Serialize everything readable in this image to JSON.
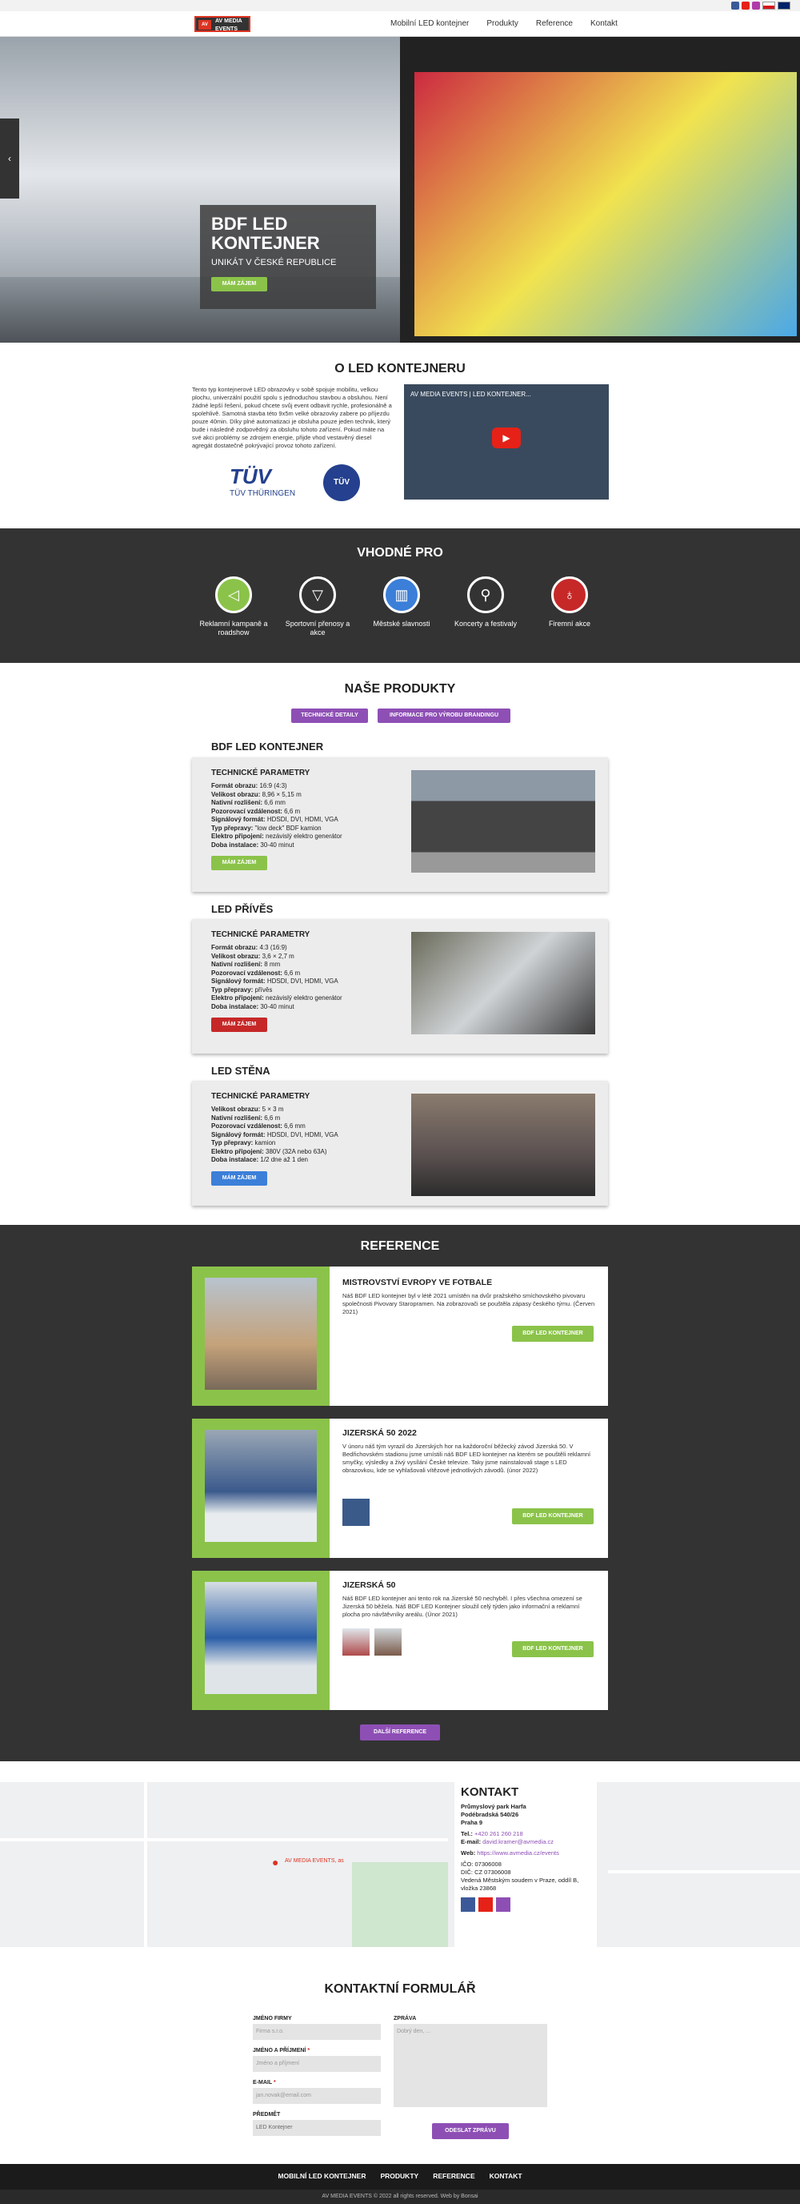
{
  "nav": {
    "logo_text": "AV MEDIA EVENTS",
    "items": [
      "Mobilní LED kontejner",
      "Produkty",
      "Reference",
      "Kontakt"
    ]
  },
  "hero": {
    "title": "BDF LED KONTEJNER",
    "subtitle": "UNIKÁT V ČESKÉ REPUBLICE",
    "button": "MÁM ZÁJEM"
  },
  "about": {
    "title": "O LED KONTEJNERU",
    "text": "Tento typ kontejnerové LED obrazovky v sobě spojuje mobilitu, velkou plochu, univerzální použití spolu s jednoduchou stavbou a obsluhou. Není žádné lepší řešení, pokud chcete svůj event odbavit rychle, profesionálně a spolehlivě. Samotná stavba této 9x5m velké obrazovky zabere po příjezdu pouze 40min. Díky plné automatizaci je obsluha pouze jeden technik, který bude i následně zodpovědný za obsluhu tohoto zařízení. Pokud máte na své akci problémy se zdrojem energie, přijde vhod vestavěný diesel agregát dostatečně pokrývající provoz tohoto zařízení.",
    "video_title": "AV MEDIA EVENTS | LED KONTEJNER...",
    "tuv_logo": "TÜV THÜRINGEN",
    "tuv_badge": "TÜV"
  },
  "suitable": {
    "title": "VHODNÉ PRO",
    "items": [
      {
        "label": "Reklamní kampaně a roadshow",
        "icon": "megaphone-icon",
        "color": "#8bc34a"
      },
      {
        "label": "Sportovní přenosy a akce",
        "icon": "sport-icon",
        "color": "#333333"
      },
      {
        "label": "Městské slavnosti",
        "icon": "building-icon",
        "color": "#3b7fd9"
      },
      {
        "label": "Koncerty a festivaly",
        "icon": "microphone-icon",
        "color": "#333333"
      },
      {
        "label": "Firemní akce",
        "icon": "lightbulb-icon",
        "color": "#c62828"
      }
    ]
  },
  "products": {
    "title": "NAŠE PRODUKTY",
    "btn1": "TECHNICKÉ DETAILY",
    "btn2": "INFORMACE PRO VÝROBU BRANDINGU",
    "spec_heading": "TECHNICKÉ PARAMETRY",
    "button": "MÁM ZÁJEM",
    "list": [
      {
        "name": "BDF LED KONTEJNER",
        "specs": [
          [
            "Formát obrazu:",
            "16:9 (4:3)"
          ],
          [
            "Velikost obrazu:",
            "8,96 × 5,15 m"
          ],
          [
            "Nativní rozlišení:",
            "6,6 mm"
          ],
          [
            "Pozorovací vzdálenost:",
            "6,6 m"
          ],
          [
            "Signálový formát:",
            "HDSDI, DVI, HDMI, VGA"
          ],
          [
            "Typ přepravy:",
            "\"low deck\" BDF kamion"
          ],
          [
            "Elektro připojení:",
            "nezávislý elektro generátor"
          ],
          [
            "Doba instalace:",
            "30-40 minut"
          ]
        ]
      },
      {
        "name": "LED PŘÍVĚS",
        "specs": [
          [
            "Formát obrazu:",
            "4:3 (16:9)"
          ],
          [
            "Velikost obrazu:",
            "3,6 × 2,7 m"
          ],
          [
            "Nativní rozlišení:",
            "8 mm"
          ],
          [
            "Pozorovací vzdálenost:",
            "6,6 m"
          ],
          [
            "Signálový formát:",
            "HDSDI, DVI, HDMI, VGA"
          ],
          [
            "Typ přepravy:",
            "přívěs"
          ],
          [
            "Elektro připojení:",
            "nezávislý elektro generátor"
          ],
          [
            "Doba instalace:",
            "30-40 minut"
          ]
        ]
      },
      {
        "name": "LED STĚNA",
        "specs": [
          [
            "Velikost obrazu:",
            "5 × 3 m"
          ],
          [
            "Nativní rozlišení:",
            "6,6 m"
          ],
          [
            "Pozorovací vzdálenost:",
            "6,6 mm"
          ],
          [
            "Signálový formát:",
            "HDSDI, DVI, HDMI, VGA"
          ],
          [
            "Typ přepravy:",
            "kamion"
          ],
          [
            "Elektro připojení:",
            "380V (32A nebo 63A)"
          ],
          [
            "Doba instalace:",
            "1/2 dne až 1 den"
          ]
        ]
      }
    ]
  },
  "reference": {
    "title": "REFERENCE",
    "more": "DALŠÍ REFERENCE",
    "button": "BDF LED KONTEJNER",
    "items": [
      {
        "title": "MISTROVSTVÍ EVROPY VE FOTBALE",
        "text": "Náš BDF LED kontejner byl v létě 2021 umístěn na dvůr pražského smíchovského pivovaru společnosti Pivovary Staropramen. Na zobrazovači se pouštěla zápasy českého týmu. (Červen 2021)"
      },
      {
        "title": "JIZERSKÁ 50 2022",
        "text": "V únoru náš tým vyrazil do Jizerských hor na každoroční běžecký závod Jizerská 50. V Bedřichovském stadionu jsme umístili náš BDF LED kontejner na kterém se pouštěli reklamní smyčky, výsledky a živý vysílání České televize. Taky jsme nainstalovali stage s LED obrazovkou, kde se vyhlašovali vítězové jednotlivých závodů. (únor 2022)"
      },
      {
        "title": "JIZERSKÁ 50",
        "text": "Náš BDF LED kontejner ani tento rok na Jizerské 50 nechyběl. I přes všechna omezení se Jizerská 50 běžela. Náš BDF LED Kontejner sloužil celý týden jako informační a reklamní plocha pro návštěvníky areálu. (Únor 2021)"
      }
    ]
  },
  "map": {
    "pin": "AV MEDIA EVENTS, as"
  },
  "contact": {
    "title": "KONTAKT",
    "address": [
      "Průmyslový park Harfa",
      "Podébradská 540/26",
      "Praha 9"
    ],
    "tel_label": "Tel.:",
    "tel": "+420 261 260 218",
    "email_label": "E-mail:",
    "email": "david.kramer@avmedia.cz",
    "web_label": "Web:",
    "web": "https://www.avmedia.cz/events",
    "ico": "IČO: 07306008",
    "dic": "DIČ: CZ 07306008",
    "reg": "Vedená Městským soudem v Praze, oddíl B, vložka 23868"
  },
  "form": {
    "title": "KONTAKTNÍ FORMULÁŘ",
    "company_label": "JMÉNO FIRMY",
    "company_ph": "Firma s.r.o.",
    "name_label": "JMÉNO A PŘÍJMENÍ",
    "name_ph": "Jméno a příjmení",
    "email_label": "E-MAIL",
    "email_ph": "jan.novak@email.com",
    "subject_label": "PŘEDMĚT",
    "subject_val": "LED Kontejner",
    "message_label": "ZPRÁVA",
    "message_ph": "Dobrý den, ...",
    "submit": "ODESLAT ZPRÁVU"
  },
  "footer": {
    "items": [
      "MOBILNÍ LED KONTEJNER",
      "PRODUKTY",
      "REFERENCE",
      "KONTAKT"
    ],
    "copyright": "AV MEDIA EVENTS © 2022 all rights reserved. Web by Bonsai"
  }
}
